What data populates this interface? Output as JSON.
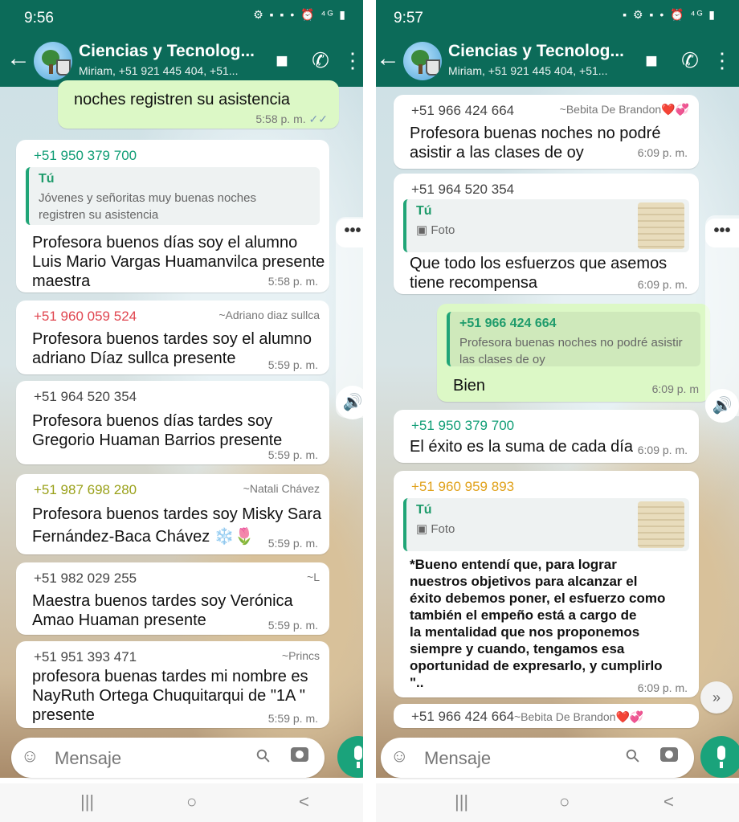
{
  "left": {
    "status": {
      "time": "9:56",
      "icons": "⚙ ▪ ▪ •  ⏰ ⁴ᴳ ▮"
    },
    "header": {
      "back": "←",
      "title": "Ciencias y Tecnolog...",
      "subtitle": "Miriam, +51 921 445 404, +51..."
    },
    "messages": [
      {
        "type": "out",
        "text": [
          "noches registren su asistencia"
        ],
        "time": "5:58 p. m.",
        "ticks": "✓✓"
      },
      {
        "sender": "+51 950 379 700",
        "sender_color": "#0f9d75",
        "quote": {
          "name": "Tú",
          "text": [
            "Jóvenes y señoritas muy buenas noches",
            "registren su asistencia"
          ]
        },
        "text": [
          "Profesora buenos días soy el alumno",
          "Luis Mario Vargas Huamanvilca presente",
          "maestra"
        ],
        "time": "5:58 p. m."
      },
      {
        "sender": "+51 960 059 524",
        "sender_color": "#e0454f",
        "alias": "~Adriano diaz sullca",
        "text": [
          "Profesora buenos tardes soy el alumno",
          "adriano Díaz sullca presente"
        ],
        "time": "5:59 p. m."
      },
      {
        "sender": "+51 964 520 354",
        "sender_color": "#444444",
        "text": [
          "Profesora buenos días tardes soy",
          "Gregorio Huaman Barrios presente"
        ],
        "time": "5:59 p. m."
      },
      {
        "sender": "+51 987 698 280",
        "sender_color": "#9aa11a",
        "alias": "~Natali Chávez",
        "text": [
          "Profesora buenos tardes soy Misky Sara",
          "Fernández-Baca Chávez ❄️🌷"
        ],
        "time": "5:59 p. m."
      },
      {
        "sender": "+51 982 029 255",
        "sender_color": "#444444",
        "alias": "~L",
        "text": [
          "Maestra buenos tardes soy Verónica",
          "Amao Huaman presente"
        ],
        "time": "5:59 p. m."
      },
      {
        "sender": "+51 951 393 471",
        "sender_color": "#444444",
        "alias": "~Princs",
        "text": [
          "profesora buenas tardes mi nombre es",
          "NayRuth Ortega Chuquitarqui de \"1A \"",
          "presente"
        ],
        "time": "5:59 p. m."
      }
    ],
    "input": {
      "placeholder": "Mensaje"
    },
    "more": "•••",
    "speaker": "🔊"
  },
  "right": {
    "status": {
      "time": "9:57",
      "icons": "▪ ⚙ ▪ •  ⏰ ⁴ᴳ ▮"
    },
    "header": {
      "back": "←",
      "title": "Ciencias y Tecnolog...",
      "subtitle": "Miriam, +51 921 445 404, +51..."
    },
    "messages": [
      {
        "sender": "+51 966 424 664",
        "sender_color": "#444444",
        "alias": "~Bebita De Brandon❤️💞",
        "text": [
          "Profesora buenas noches no podré",
          "asistir a las clases de oy"
        ],
        "time": "6:09 p. m."
      },
      {
        "sender": "+51 964 520 354",
        "sender_color": "#444444",
        "quote": {
          "name": "Tú",
          "text": [
            "▣ Foto"
          ],
          "thumb": true
        },
        "text": [
          "Que todo los esfuerzos que asemos",
          "tiene recompensa"
        ],
        "time": "6:09 p. m."
      },
      {
        "type": "out",
        "quote": {
          "name": "+51 966 424 664",
          "text": [
            "Profesora buenas noches no podré asistir",
            "las clases de oy"
          ]
        },
        "text": [
          "Bien"
        ],
        "time": "6:09 p. m"
      },
      {
        "sender": "+51 950 379 700",
        "sender_color": "#0f9d75",
        "text": [
          "El éxito es la suma de cada día"
        ],
        "time": "6:09 p. m."
      },
      {
        "sender": "+51 960 959 893",
        "sender_color": "#e0a11a",
        "quote": {
          "name": "Tú",
          "text": [
            "▣ Foto"
          ],
          "thumb": true
        },
        "text": [
          "*Bueno entendí que, para lograr",
          "nuestros objetivos para alcanzar el",
          "éxito debemos poner, el esfuerzo como",
          "también el empeño está a cargo de",
          "la mentalidad  que nos proponemos",
          "siempre y cuando, tengamos esa",
          "oportunidad de expresarlo, y cumplirlo",
          "\".."
        ],
        "time": "6:09 p. m."
      },
      {
        "sender": "+51 966 424 664",
        "sender_color": "#444444",
        "alias": "~Bebita De Brandon❤️💞"
      }
    ],
    "input": {
      "placeholder": "Mensaje"
    },
    "more": "•••",
    "speaker": "🔊",
    "down": "»"
  },
  "nav": {
    "recent": "|||",
    "home": "○",
    "back": "<"
  }
}
